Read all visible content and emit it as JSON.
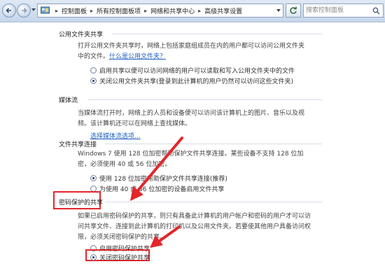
{
  "address_bar": {
    "crumbs": [
      "控制面板",
      "所有控制面板项",
      "网络和共享中心",
      "高级共享设置"
    ]
  },
  "search": {
    "placeholder": "搜索控制面板"
  },
  "sections": {
    "public": {
      "title": "公用文件夹共享",
      "desc": "打开公用文件夹共享时，网络上包括家庭组成员在内的用户都可以访问公用文件夹中的文件。",
      "link": "什么是公用文件夹？",
      "options": [
        {
          "label": "启用共享以便可以访问网络的用户可以读取和写入公用文件夹中的文件",
          "selected": false
        },
        {
          "label": "关闭公用文件夹共享(登录到此计算机的用户仍然可以访问这些文件夹)",
          "selected": true
        }
      ]
    },
    "media": {
      "title": "媒体流",
      "desc": "当媒体流打开时，网络上的人员和设备便可以访问该计算机上的图片、音乐以及视频。该计算机还可以在网络上查找媒体。",
      "link": "选择媒体流选项..."
    },
    "file_sharing": {
      "title": "文件共享连接",
      "desc": "Windows 7 使用 128 位加密帮助保护文件共享连接。某些设备不支持 128 位加密，必须使用 40 或 56 位加密。",
      "options": [
        {
          "label": "使用 128 位加密帮助保护文件共享连接(推荐)",
          "selected": true
        },
        {
          "label": "为使用 40 或 56 位加密的设备启用文件共享",
          "selected": false
        }
      ]
    },
    "password": {
      "title": "密码保护的共享",
      "desc": "如果已启用密码保护的共享，则只有具备此计算机的用户帐户和密码的用户才可以访问共享文件、连接到此计算机的打印机以及公用文件夹。若要使其他用户具备访问权限，必须关闭密码保护的共享。",
      "options": [
        {
          "label": "启用密码保护共享",
          "selected": false
        },
        {
          "label": "关闭密码保护共享",
          "selected": true
        }
      ]
    }
  },
  "colors": {
    "annotation_red": "#e2272b",
    "link_blue": "#1f5fbf"
  }
}
